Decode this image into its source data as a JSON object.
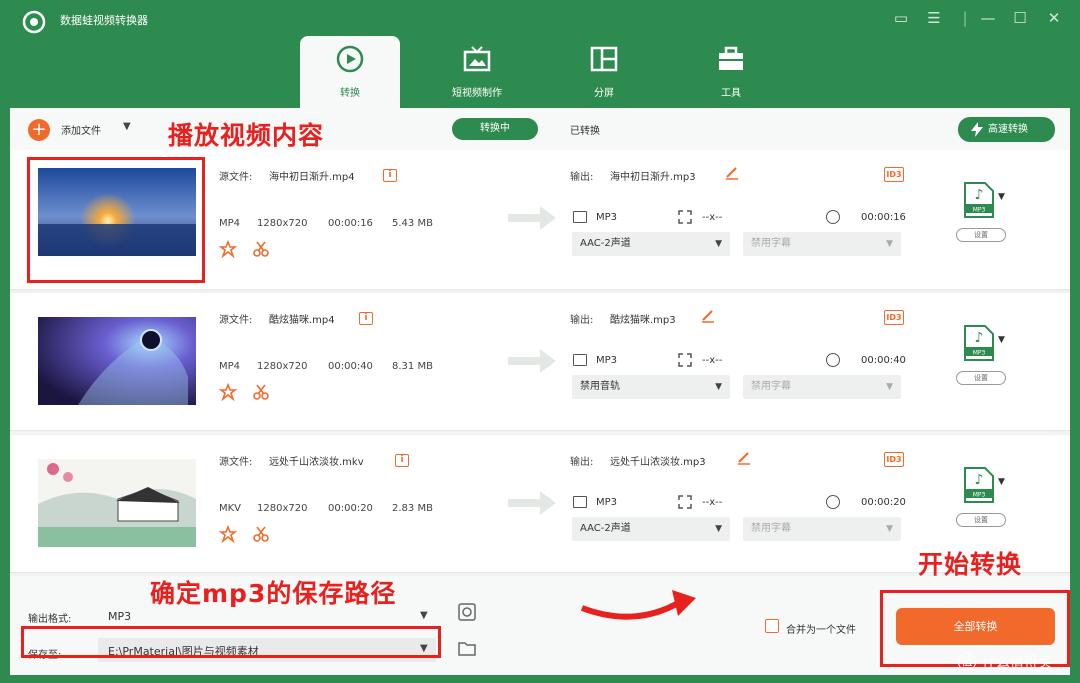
{
  "app": {
    "title": "数据蛙视频转换器"
  },
  "tabs": [
    {
      "label": "转换",
      "icon": "convert-icon",
      "active": true
    },
    {
      "label": "短视频制作",
      "icon": "tv-icon",
      "active": false
    },
    {
      "label": "分屏",
      "icon": "split-screen-icon",
      "active": false
    },
    {
      "label": "工具",
      "icon": "toolbox-icon",
      "active": false
    }
  ],
  "toolbar": {
    "add_label": "添加文件",
    "converting": "转换中",
    "converted": "已转换",
    "fast_convert": "高速转换"
  },
  "annotations": {
    "play": "播放视频内容",
    "save_path": "确定mp3的保存路径",
    "start": "开始转换"
  },
  "files": [
    {
      "src_label": "源文件:",
      "src_name": "海中初日渐升.mp4",
      "format": "MP4",
      "resolution": "1280x720",
      "duration": "00:00:16",
      "size": "5.43 MB",
      "out_label": "输出:",
      "out_name": "海中初日渐升.mp3",
      "out_format": "MP3",
      "out_res": "--x--",
      "out_dur": "00:00:16",
      "audio": "AAC-2声道",
      "subtitle": "禁用字幕",
      "set": "设置"
    },
    {
      "src_label": "源文件:",
      "src_name": "酷炫猫咪.mp4",
      "format": "MP4",
      "resolution": "1280x720",
      "duration": "00:00:40",
      "size": "8.31 MB",
      "out_label": "输出:",
      "out_name": "酷炫猫咪.mp3",
      "out_format": "MP3",
      "out_res": "--x--",
      "out_dur": "00:00:40",
      "audio": "禁用音轨",
      "subtitle": "禁用字幕",
      "set": "设置"
    },
    {
      "src_label": "源文件:",
      "src_name": "远处千山浓淡妆.mkv",
      "format": "MKV",
      "resolution": "1280x720",
      "duration": "00:00:20",
      "size": "2.83 MB",
      "out_label": "输出:",
      "out_name": "远处千山浓淡妆.mp3",
      "out_format": "MP3",
      "out_res": "--x--",
      "out_dur": "00:00:20",
      "audio": "AAC-2声道",
      "subtitle": "禁用字幕",
      "set": "设置"
    }
  ],
  "bottom": {
    "output_format_label": "输出格式:",
    "output_format": "MP3",
    "save_to_label": "保存至:",
    "save_path": "E:\\PrMaterial\\图片与视频素材",
    "merge_label": "合并为一个文件",
    "convert_all": "全部转换"
  },
  "watermark": "什么值得买",
  "colors": {
    "brand_green": "#2e8b4f",
    "accent_orange": "#f26a2b",
    "annotation_red": "#e8201e"
  }
}
